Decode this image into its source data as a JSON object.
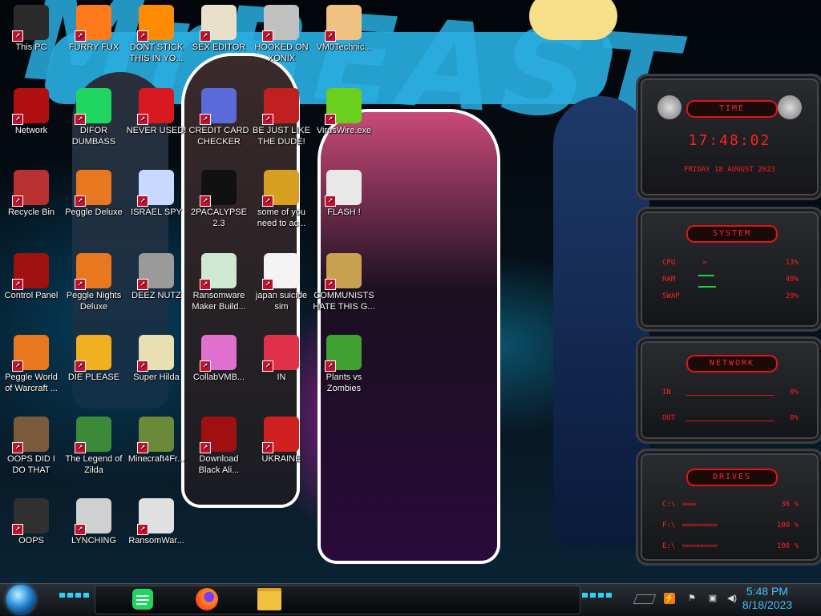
{
  "wallpaper": {
    "banner_text": "MrBEAST"
  },
  "desktop_icons": [
    {
      "label": "This PC",
      "icon": "this-pc-icon",
      "color": "#2b2b2b"
    },
    {
      "label": "FURRY FUX",
      "icon": "firefox-icon",
      "color": "#ff7a1a"
    },
    {
      "label": "DONT STICK THIS IN YO...",
      "icon": "vlc-icon",
      "color": "#ff8c00"
    },
    {
      "label": "SEX EDITOR",
      "icon": "editor-icon",
      "color": "#e8e0c8"
    },
    {
      "label": "HOOKED ON XONIX",
      "icon": "xonix-icon",
      "color": "#c0c0c0"
    },
    {
      "label": "VM0Technic...",
      "icon": "technician-icon",
      "color": "#f0c080"
    },
    {
      "label": "Network",
      "icon": "network-icon",
      "color": "#b01010"
    },
    {
      "label": "DIFOR DUMBASS",
      "icon": "spotify-icon",
      "color": "#1fd760"
    },
    {
      "label": "NEVER USED!",
      "icon": "dev-icon",
      "color": "#d71920"
    },
    {
      "label": "CREDIT CARD CHECKER",
      "icon": "credit-card-icon",
      "color": "#5a6ad8"
    },
    {
      "label": "BE JUST LIKE THE DUDE!",
      "icon": "dude-icon",
      "color": "#c02020"
    },
    {
      "label": "VirusWire.exe",
      "icon": "limewire-icon",
      "color": "#6ad020"
    },
    {
      "label": "Recycle Bin",
      "icon": "recycle-bin-icon",
      "color": "#b83030"
    },
    {
      "label": "Peggle Deluxe",
      "icon": "peggle-icon",
      "color": "#e87820"
    },
    {
      "label": "ISRAEL SPY",
      "icon": "spy-icon",
      "color": "#c8d8ff"
    },
    {
      "label": "2PACALYPSE 2.3",
      "icon": "terminal-icon",
      "color": "#111111"
    },
    {
      "label": "some of you need to ac...",
      "icon": "beaver-icon",
      "color": "#d8a020"
    },
    {
      "label": "FLASH !",
      "icon": "flash-icon",
      "color": "#e8e8e8"
    },
    {
      "label": "Control Panel",
      "icon": "control-panel-icon",
      "color": "#a01010"
    },
    {
      "label": "Peggle Nights Deluxe",
      "icon": "peggle-nights-icon",
      "color": "#e87820"
    },
    {
      "label": "DEEZ NUTZ",
      "icon": "windows-stack-icon",
      "color": "#9a9a9a"
    },
    {
      "label": "Ransomware Maker Build...",
      "icon": "ransomware-maker-icon",
      "color": "#cfe8d0"
    },
    {
      "label": "japan suicide sim",
      "icon": "document-icon",
      "color": "#f4f4f4"
    },
    {
      "label": "COMMUNISTS HATE THIS G...",
      "icon": "money-bag-icon",
      "color": "#c8a050"
    },
    {
      "label": "Peggle World of Warcraft ...",
      "icon": "peggle-wow-icon",
      "color": "#e87820"
    },
    {
      "label": "DIE PLEASE",
      "icon": "director-icon",
      "color": "#f0b020"
    },
    {
      "label": "Super Hilda",
      "icon": "pixel-art-icon",
      "color": "#e8e0b0"
    },
    {
      "label": "CollabVMB...",
      "icon": "collabvm-icon",
      "color": "#e070d0"
    },
    {
      "label": "IN",
      "icon": "star-butterfly-icon",
      "color": "#e0304a"
    },
    {
      "label": "Plants vs Zombies",
      "icon": "pvz-icon",
      "color": "#40a030"
    },
    {
      "label": "OOPS DID I DO THAT",
      "icon": "painting-icon",
      "color": "#7a5a3a"
    },
    {
      "label": "The Legend of Zilda",
      "icon": "zelda-icon",
      "color": "#3a8a3a"
    },
    {
      "label": "Minecraft4Fr...",
      "icon": "minecraft-icon",
      "color": "#6a8a3a"
    },
    {
      "label": "Download Black Ali...",
      "icon": "alienware-icon",
      "color": "#a01010"
    },
    {
      "label": "UKRAINE",
      "icon": "radiation-icon",
      "color": "#d02020"
    },
    {
      "label": "OOPS",
      "icon": "computer-icon",
      "color": "#303030"
    },
    {
      "label": "LYNCHING",
      "icon": "gallows-icon",
      "color": "#d0d0d0"
    },
    {
      "label": "RansomWar...",
      "icon": "skull-icon",
      "color": "#e0e0e0"
    }
  ],
  "widgets": {
    "time": {
      "title": "TIME",
      "clock": "17:48:02",
      "date": "FRIDAY 18 AUGUST 2023"
    },
    "system": {
      "title": "SYSTEM",
      "rows": [
        {
          "label": "CPU",
          "value": "13%",
          "level": 0.13
        },
        {
          "label": "RAM",
          "value": "48%",
          "level": 0.48
        },
        {
          "label": "SWAP",
          "value": "29%",
          "level": 0.29
        }
      ]
    },
    "network": {
      "title": "NETWORK",
      "rows": [
        {
          "label": "IN",
          "value": "0%"
        },
        {
          "label": "OUT",
          "value": "0%"
        }
      ]
    },
    "drives": {
      "title": "DRIVES",
      "rows": [
        {
          "label": "C:\\",
          "value": "36 %",
          "level": 0.36
        },
        {
          "label": "F:\\",
          "value": "100 %",
          "level": 1.0
        },
        {
          "label": "E:\\",
          "value": "100 %",
          "level": 1.0
        }
      ]
    }
  },
  "taskbar": {
    "pinned": [
      {
        "icon": "spotify-icon",
        "color": "#1fd760"
      },
      {
        "icon": "firefox-icon",
        "color": "#ff7a1a"
      },
      {
        "icon": "file-explorer-icon",
        "color": "#f0c040"
      }
    ],
    "tray": [
      "security-icon",
      "flag-icon",
      "network-icon",
      "volume-icon"
    ],
    "time": "5:48 PM",
    "date": "8/18/2023"
  }
}
